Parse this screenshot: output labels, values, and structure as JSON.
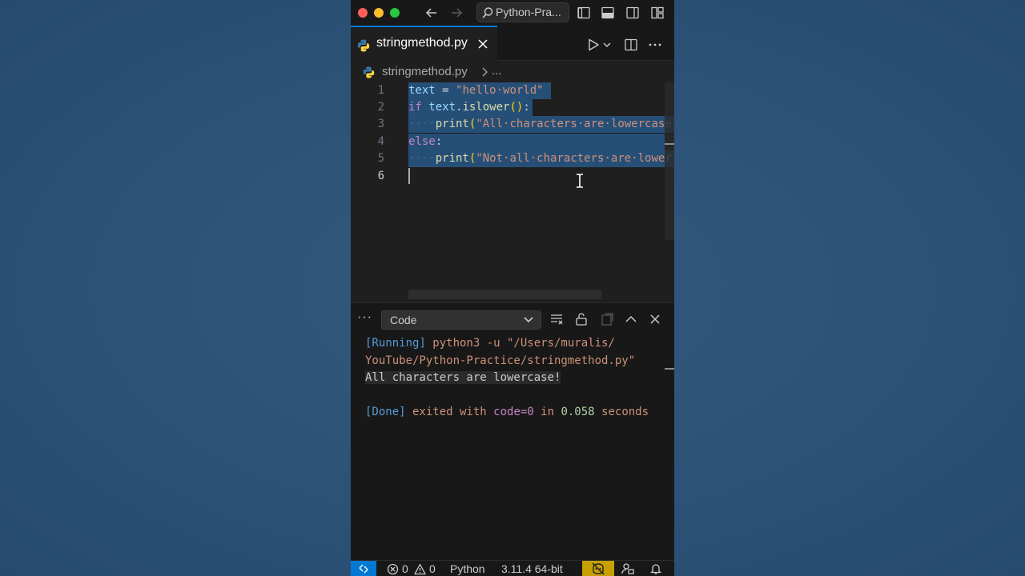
{
  "titlebar": {
    "command_center_label": "Python-Pra..."
  },
  "tab": {
    "filename": "stringmethod.py"
  },
  "breadcrumb": {
    "file": "stringmethod.py",
    "more": "..."
  },
  "editor": {
    "line_numbers": [
      "1",
      "2",
      "3",
      "4",
      "5",
      "6"
    ],
    "lines": [
      "text = \"hello world\"",
      "if text.islower():",
      "    print(\"All characters are lowercase",
      "else:",
      "    print(\"Not all characters are lower",
      ""
    ]
  },
  "panel": {
    "output_channel": "Code",
    "output": {
      "running_tag": "[Running]",
      "running_cmd_1": " python3 -u \"/Users/muralis/",
      "running_cmd_2": "YouTube/Python-Practice/stringmethod.py\"",
      "result": "All characters are lowercase!",
      "done_tag": "[Done]",
      "exited_with": " exited with ",
      "code": "code=0",
      "in": " in ",
      "duration": "0.058",
      "seconds": " seconds"
    }
  },
  "statusbar": {
    "errors": "0",
    "warnings": "0",
    "language": "Python",
    "interpreter": "3.11.4 64-bit"
  },
  "colors": {
    "accent": "#0078d4",
    "copilot_badge": "#c6a000",
    "selection": "#264f78"
  }
}
